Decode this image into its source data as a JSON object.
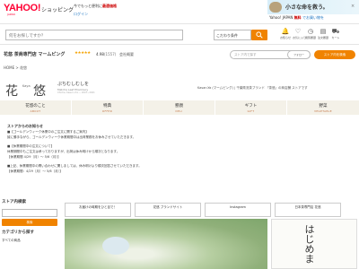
{
  "header": {
    "logo": "YAHOO!",
    "logo_sub": "JAPAN",
    "service": "ショッピング",
    "login": "ログイン",
    "promo_prefix": "今でもっと便利に",
    "promo_bold": "最適価格",
    "ad_text": "小さな命を救う。",
    "ad_close": "×",
    "yj_prefix": "Yahoo! JAPAN",
    "yj_bold": "無料",
    "yj_link": "でお買い物を"
  },
  "search": {
    "placeholder": "何をお探しですか？",
    "scope": "こだわり条件",
    "icons": [
      {
        "name": "notification-icon",
        "glyph": "🔔",
        "label": "お知らせ"
      },
      {
        "name": "favorite-icon",
        "glyph": "♡",
        "label": "お気に入り"
      },
      {
        "name": "history-icon",
        "glyph": "◷",
        "label": "閲覧履歴"
      },
      {
        "name": "order-icon",
        "glyph": "▤",
        "label": "注文履歴"
      },
      {
        "name": "cart-icon",
        "glyph": "⛟",
        "label": "カート"
      }
    ]
  },
  "store": {
    "name": "花悠 茶商専門店 マームピング",
    "stars": "★★★★★",
    "rating": "4.98",
    "count": "(1557)",
    "company": "会社概要",
    "follow": "フォロー",
    "search_placeholder": "ストア内で探す",
    "top_button": "ストア内を検索"
  },
  "breadcrumb": "HOME > 花悠",
  "brand": {
    "kanji1": "花",
    "kaya": "Kaya",
    "kanji2": "悠",
    "hira": "ぷちむしむしを",
    "en": "Matcha Leaf Pharmacy",
    "addr": "Chicha, Kasuri-cho  ~ 2007~2021",
    "desc": "Kasan-Ya (マームピング) | 千葉県流茶ブランド 『茶悠』の商店舗 ストアです"
  },
  "nav": [
    {
      "jp": "花悠のこと",
      "en": "ABOUT"
    },
    {
      "jp": "特典",
      "en": "OFFER"
    },
    {
      "jp": "懇親",
      "en": "DELI"
    },
    {
      "jp": "ギフト",
      "en": "GIFT"
    },
    {
      "jp": "野菜",
      "en": "VEGETABLE"
    }
  ],
  "notice": {
    "title": "ストアからのお知らせ",
    "lines": [
      "■【ゴールデンウィーク休業中のご注文に関するご案内】",
      "誠に勝手ながら、ゴールデンウィーク休業期間中は出荷業務をお休みさせていただきます。",
      "",
      "■【休業期間中の注文について】",
      "休業期間中もご注文は承っておりますが、出荷は休み明けから順次となります。",
      "【休業期間 4/29（月）～ 5/6（月）】",
      "",
      "■上記、休業期間中の問い合わせに関しましては、休み明けより順次回答させていただきます。",
      "【休業期間：4/29（月）～ 5/6（月）】"
    ]
  },
  "sidebar": {
    "search_heading": "ストア内検索",
    "search_button": "検索",
    "category_heading": "カテゴリから探す",
    "category_all": "すべての商品"
  },
  "banners": [
    {
      "label": "お届けの時期をひと目で！"
    },
    {
      "label": "花悠 ブランドサイト"
    },
    {
      "label": "Instagram"
    },
    {
      "label": "日本茶専門店 花悠"
    }
  ],
  "feature": {
    "vertical_text": "はじめま"
  }
}
